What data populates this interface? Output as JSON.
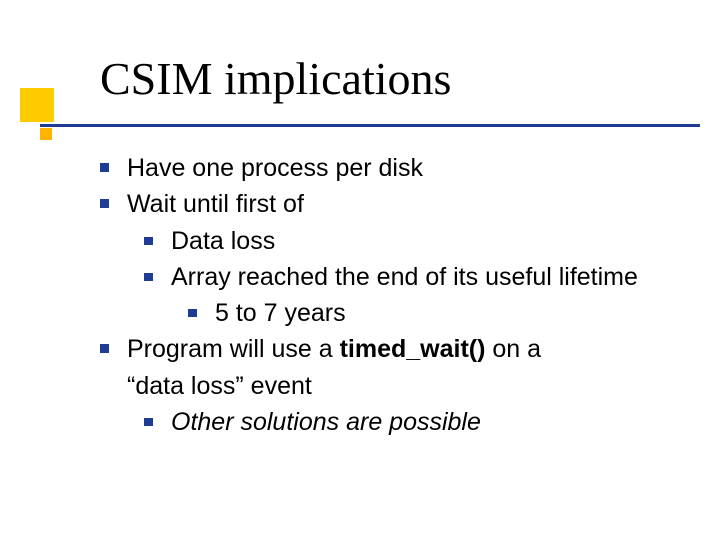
{
  "title": "CSIM implications",
  "bullets": {
    "b1": "Have one process per disk",
    "b2": "Wait until first of",
    "b2a": "Data loss",
    "b2b": "Array reached the end of its useful lifetime",
    "b2b1": "5 to 7 years",
    "b3_pre": "Program will use a ",
    "b3_code": "timed_wait()",
    "b3_mid": " on a ",
    "b3_post1": "“data loss”",
    "b3_post2": "  event",
    "b3a": "Other solutions are possible"
  }
}
